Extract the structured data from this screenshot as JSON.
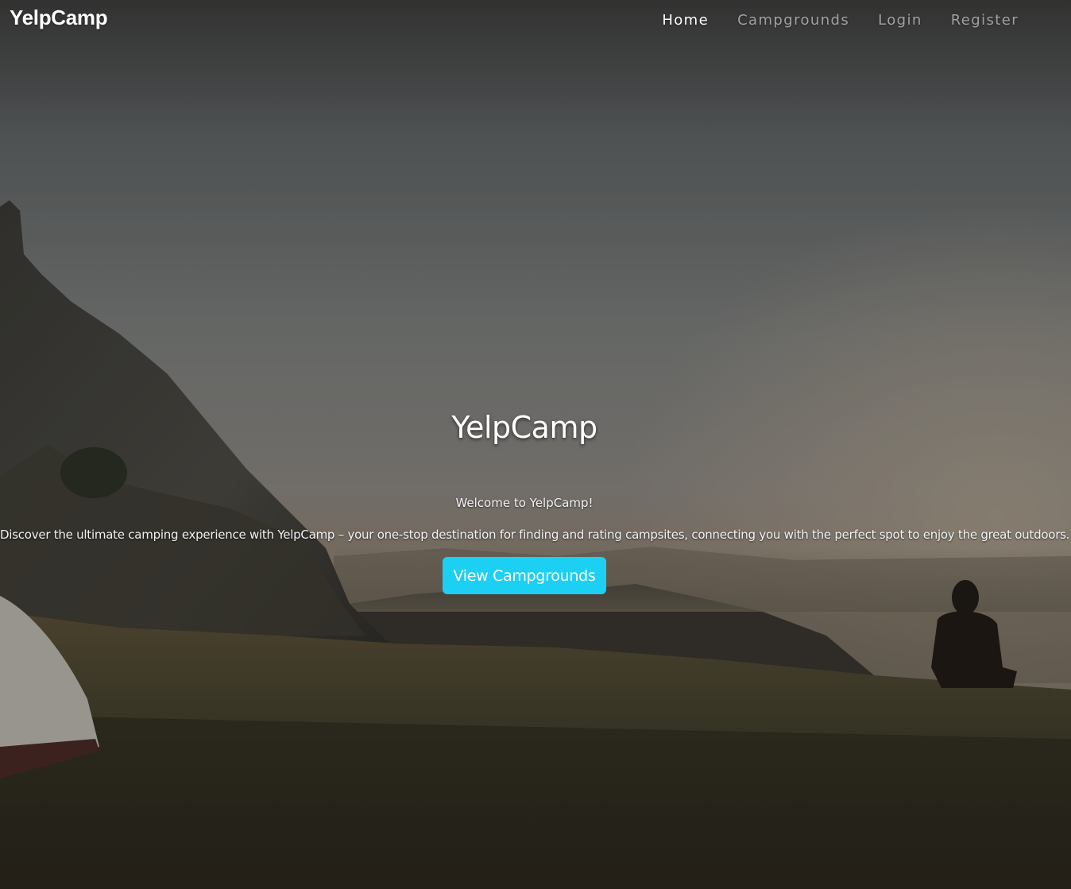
{
  "navbar": {
    "brand": "YelpCamp",
    "links": [
      {
        "label": "Home",
        "active": true
      },
      {
        "label": "Campgrounds",
        "active": false
      },
      {
        "label": "Login",
        "active": false
      },
      {
        "label": "Register",
        "active": false
      }
    ]
  },
  "hero": {
    "title": "YelpCamp",
    "welcome": "Welcome to YelpCamp!",
    "description": "Discover the ultimate camping experience with YelpCamp – your one-stop destination for finding and rating campsites, connecting you with the perfect spot to enjoy the great outdoors.",
    "button_label": "View Campgrounds"
  },
  "colors": {
    "button_bg": "#1bd0f2",
    "nav_active": "#ffffff",
    "nav_inactive": "rgba(255,255,255,0.55)"
  }
}
